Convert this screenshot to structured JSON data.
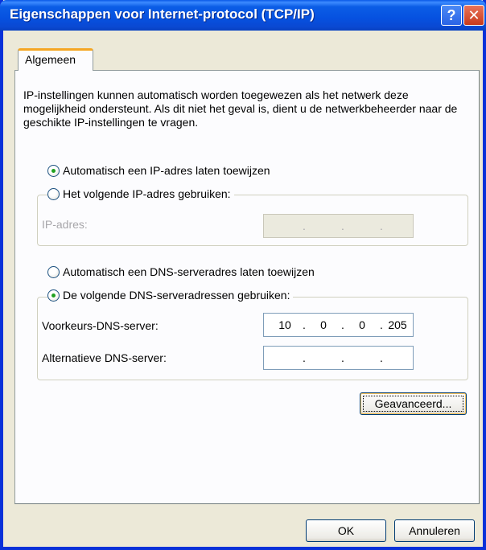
{
  "window": {
    "title": "Eigenschappen voor Internet-protocol (TCP/IP)",
    "help_glyph": "?",
    "close_glyph": "✕"
  },
  "tab": {
    "label": "Algemeen"
  },
  "description": "IP-instellingen kunnen automatisch worden toegewezen als het netwerk deze mogelijkheid ondersteunt. Als dit niet het geval is, dient u de netwerkbeheerder naar de geschikte IP-instellingen te vragen.",
  "ip": {
    "auto_label": "Automatisch een IP-adres laten toewijzen",
    "auto_checked": true,
    "manual_label": "Het volgende IP-adres gebruiken:",
    "manual_checked": false,
    "address_label": "IP-adres:",
    "address_value": [
      "",
      "",
      "",
      ""
    ]
  },
  "dns": {
    "auto_label": "Automatisch een DNS-serveradres laten toewijzen",
    "auto_checked": false,
    "manual_label": "De volgende DNS-serveradressen gebruiken:",
    "manual_checked": true,
    "preferred_label": "Voorkeurs-DNS-server:",
    "preferred_value": [
      "10",
      "0",
      "0",
      "205"
    ],
    "alternate_label": "Alternatieve DNS-server:",
    "alternate_value": [
      "",
      "",
      "",
      ""
    ]
  },
  "buttons": {
    "advanced": "Geavanceerd...",
    "ok": "OK",
    "cancel": "Annuleren"
  },
  "colors": {
    "title_bar": "#0a5ae8",
    "tab_highlight": "#f5a623",
    "radio_dot": "#21a121"
  }
}
